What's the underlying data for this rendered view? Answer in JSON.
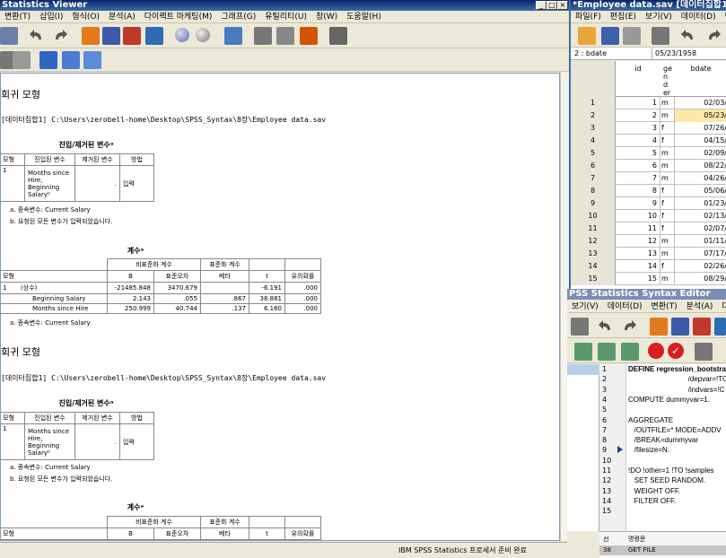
{
  "viewer": {
    "title": "Statistics Viewer",
    "menu": [
      "변환(T)",
      "삽입(I)",
      "형식(O)",
      "분석(A)",
      "다이렉트 마케팅(M)",
      "그래프(G)",
      "유틸리티(U)",
      "창(W)",
      "도움말(H)"
    ],
    "status": "IBM SPSS Statistics 프로세서 준비 완료",
    "blocks": [
      {
        "heading": "회귀 모형",
        "dataset": "[데이터집합1] C:\\Users\\zerobell-home\\Desktop\\SPSS_Syntax\\8장\\Employee data.sav",
        "entered": {
          "caption": "진입/제거된 변수ᵃ",
          "headers": [
            "모형",
            "진입된 변수",
            "제거된 변수",
            "방법"
          ],
          "row": {
            "model": "1",
            "vars": "Months since Hire, Beginning Salaryᵇ",
            "removed": ".",
            "method": "입력"
          },
          "notes": [
            "a. 종속변수: Current Salary",
            "b. 요청된 모든 변수가 입력되었습니다."
          ]
        },
        "coef": {
          "caption": "계수ᵃ",
          "group_unstd": "비표준화 계수",
          "group_std": "표준화 계수",
          "headers": [
            "모형",
            "B",
            "표준오차",
            "베타",
            "t",
            "유의확률"
          ],
          "rows": [
            {
              "model": "1",
              "name": "(상수)",
              "b": "-21485.848",
              "se": "3470.679",
              "beta": "",
              "t": "-6.191",
              "sig": ".000"
            },
            {
              "model": "",
              "name": "Beginning Salary",
              "b": "2.143",
              "se": ".055",
              "beta": ".867",
              "t": "38.881",
              "sig": ".000"
            },
            {
              "model": "",
              "name": "Months since Hire",
              "b": "250.999",
              "se": "40.744",
              "beta": ".137",
              "t": "6.160",
              "sig": ".000"
            }
          ],
          "note": "a. 종속변수: Current Salary"
        }
      },
      {
        "heading": "회귀 모형",
        "dataset": "[데이터집합1] C:\\Users\\zerobell-home\\Desktop\\SPSS_Syntax\\8장\\Employee data.sav",
        "entered": {
          "caption": "진입/제거된 변수ᵃ",
          "headers": [
            "모형",
            "진입된 변수",
            "제거된 변수",
            "방법"
          ],
          "row": {
            "model": "1",
            "vars": "Months since Hire, Beginning Salaryᵇ",
            "removed": ".",
            "method": "입력"
          },
          "notes": [
            "a. 종속변수: Current Salary",
            "b. 요청된 모든 변수가 입력되었습니다."
          ]
        },
        "coef": {
          "caption": "계수ᵃ",
          "group_unstd": "비표준화 계수",
          "group_std": "표준화 계수",
          "headers": [
            "모형",
            "B",
            "표준오차",
            "베타",
            "t",
            "유의확률"
          ]
        }
      }
    ]
  },
  "data_editor": {
    "title": "*Employee data.sav [데이터집합1] - IB",
    "menu": [
      "파일(F)",
      "편집(E)",
      "보기(V)",
      "데이터(D)",
      "변환"
    ],
    "cell_ref": "2 : bdate",
    "cell_value": "05/23/1958",
    "columns": [
      "id",
      "ge nd er",
      "bdate"
    ],
    "rows": [
      {
        "n": "1",
        "id": "1",
        "g": "m",
        "d": "02/03/"
      },
      {
        "n": "2",
        "id": "2",
        "g": "m",
        "d": "05/23/"
      },
      {
        "n": "3",
        "id": "3",
        "g": "f",
        "d": "07/26/"
      },
      {
        "n": "4",
        "id": "4",
        "g": "f",
        "d": "04/15/"
      },
      {
        "n": "5",
        "id": "5",
        "g": "m",
        "d": "02/09/"
      },
      {
        "n": "6",
        "id": "6",
        "g": "m",
        "d": "08/22/"
      },
      {
        "n": "7",
        "id": "7",
        "g": "m",
        "d": "04/26/"
      },
      {
        "n": "8",
        "id": "8",
        "g": "f",
        "d": "05/06/"
      },
      {
        "n": "9",
        "id": "9",
        "g": "f",
        "d": "01/23/"
      },
      {
        "n": "10",
        "id": "10",
        "g": "f",
        "d": "02/13/"
      },
      {
        "n": "11",
        "id": "11",
        "g": "f",
        "d": "02/07/"
      },
      {
        "n": "12",
        "id": "12",
        "g": "m",
        "d": "01/11/"
      },
      {
        "n": "13",
        "id": "13",
        "g": "m",
        "d": "07/17/"
      },
      {
        "n": "14",
        "id": "14",
        "g": "f",
        "d": "02/26/"
      },
      {
        "n": "15",
        "id": "15",
        "g": "m",
        "d": "08/29/"
      }
    ]
  },
  "syntax_editor": {
    "title": "PSS Statistics Syntax Editor",
    "menu": [
      "보기(V)",
      "데이터(D)",
      "변환(T)",
      "분석(A)",
      "다이렉트 마케팅"
    ],
    "lines": [
      {
        "n": "1",
        "text": "DEFINE regression_bootstrap ("
      },
      {
        "n": "2",
        "text": "                              /depvar=!TO"
      },
      {
        "n": "3",
        "text": "                              /indvars=!C"
      },
      {
        "n": "4",
        "text": "COMPUTE dummyvar=1."
      },
      {
        "n": "5",
        "text": ""
      },
      {
        "n": "6",
        "text": "AGGREGATE"
      },
      {
        "n": "7",
        "text": "   /OUTFILE=* MODE=ADDV"
      },
      {
        "n": "8",
        "text": "   /BREAK=dummyvar"
      },
      {
        "n": "9",
        "text": "   /filesize=N."
      },
      {
        "n": "10",
        "text": ""
      },
      {
        "n": "11",
        "text": "!DO !other=1 !TO !samples"
      },
      {
        "n": "12",
        "text": "   SET SEED RANDOM."
      },
      {
        "n": "13",
        "text": "   WEIGHT OFF."
      },
      {
        "n": "14",
        "text": "   FILTER OFF."
      },
      {
        "n": "15",
        "text": ""
      }
    ],
    "bottom_headers": [
      "선",
      "명령문"
    ],
    "bottom_row": {
      "n": "38",
      "cmd": "GET FILE"
    }
  }
}
